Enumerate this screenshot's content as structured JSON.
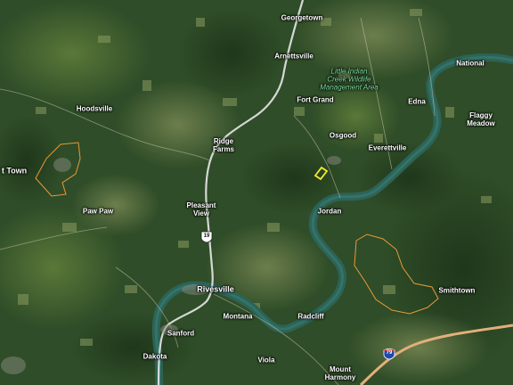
{
  "map": {
    "places": [
      {
        "id": "georgetown",
        "text": "Georgetown"
      },
      {
        "id": "national",
        "text": "National"
      },
      {
        "id": "arnettsville",
        "text": "Arnettsville"
      },
      {
        "id": "fort-grand",
        "text": "Fort Grand"
      },
      {
        "id": "edna",
        "text": "Edna"
      },
      {
        "id": "flaggy-meadow",
        "text": "Flaggy\nMeadow"
      },
      {
        "id": "hoodsville",
        "text": "Hoodsville"
      },
      {
        "id": "osgood",
        "text": "Osgood"
      },
      {
        "id": "everettville",
        "text": "Everettville"
      },
      {
        "id": "ridge-farms",
        "text": "Ridge\nFarms"
      },
      {
        "id": "t-town",
        "text": "t Town"
      },
      {
        "id": "paw-paw",
        "text": "Paw Paw"
      },
      {
        "id": "pleasant-view",
        "text": "Pleasant\nView"
      },
      {
        "id": "jordan",
        "text": "Jordan"
      },
      {
        "id": "smithtown",
        "text": "Smithtown"
      },
      {
        "id": "rivesville",
        "text": "Rivesville"
      },
      {
        "id": "montana",
        "text": "Montana"
      },
      {
        "id": "radcliff",
        "text": "Radcliff"
      },
      {
        "id": "sanford",
        "text": "Sanford"
      },
      {
        "id": "dakota",
        "text": "Dakota"
      },
      {
        "id": "viola",
        "text": "Viola"
      },
      {
        "id": "mount-harmony",
        "text": "Mount\nHarmony"
      }
    ],
    "area_label": "Little Indian\nCreek Wildlife\nManagement Area",
    "shields": [
      {
        "id": "us-19",
        "number": "19",
        "type": "us-route"
      },
      {
        "id": "i-79",
        "number": "79",
        "type": "interstate"
      }
    ],
    "colors": {
      "river": "#2c6358",
      "highway": "#e8e8e8",
      "interstate": "#e2b07a",
      "boundary": "#e89a3a",
      "parcel": "#f2ee2a"
    }
  }
}
